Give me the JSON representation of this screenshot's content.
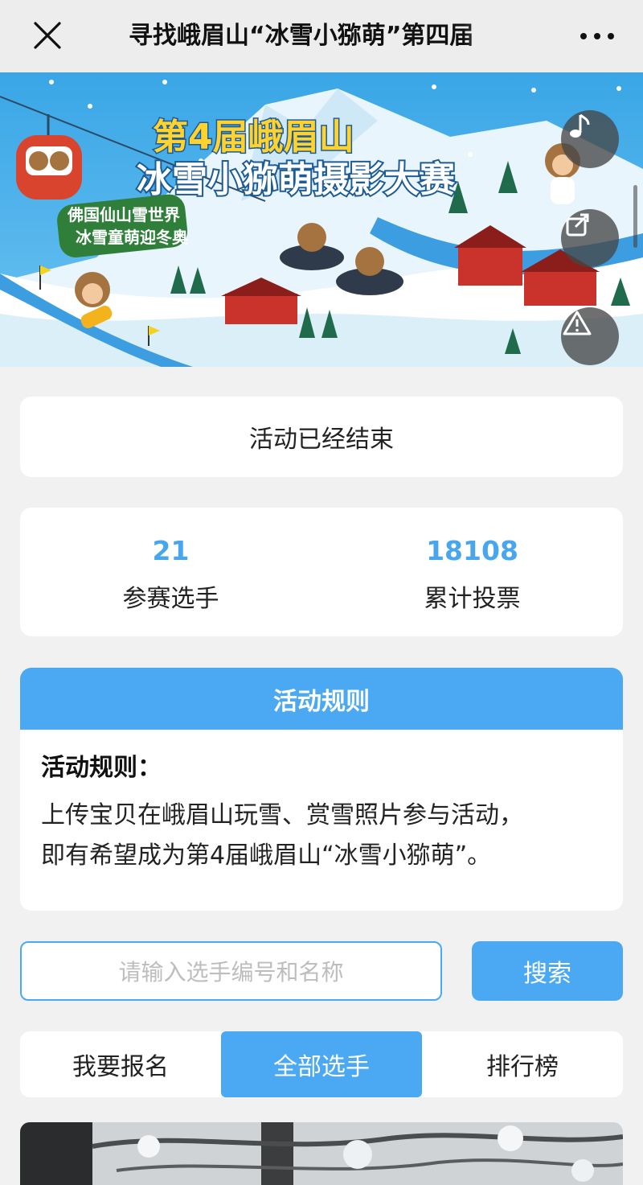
{
  "topbar": {
    "title": "寻找峨眉山“冰雪小猕萌”第四届",
    "close_icon": "close-icon",
    "more_icon": "more-dots-icon"
  },
  "banner": {
    "title_line1": "第4届峨眉山",
    "title_line2": "冰雪小猕萌摄影大赛",
    "slogan_line1": "佛国仙山雪世界",
    "slogan_line2": "冰雪童萌迎冬奥",
    "music_icon": "music-note-icon",
    "share_icon": "share-icon",
    "report_icon": "warning-icon"
  },
  "status": {
    "text": "活动已经结束"
  },
  "stats": {
    "players": {
      "value": "21",
      "label": "参赛选手"
    },
    "votes": {
      "value": "18108",
      "label": "累计投票"
    }
  },
  "rules": {
    "header": "活动规则",
    "title": "活动规则：",
    "line1": "上传宝贝在峨眉山玩雪、赏雪照片参与活动，",
    "line2": "即有希望成为第4届峨眉山“冰雪小猕萌”。"
  },
  "search": {
    "placeholder": "请输入选手编号和名称",
    "button": "搜索"
  },
  "tabs": {
    "signup": "我要报名",
    "all": "全部选手",
    "ranking": "排行榜",
    "active": "all"
  },
  "colors": {
    "accent": "#4aa9f2",
    "stat_number": "#47a6ee",
    "background": "#f1f1f1"
  }
}
